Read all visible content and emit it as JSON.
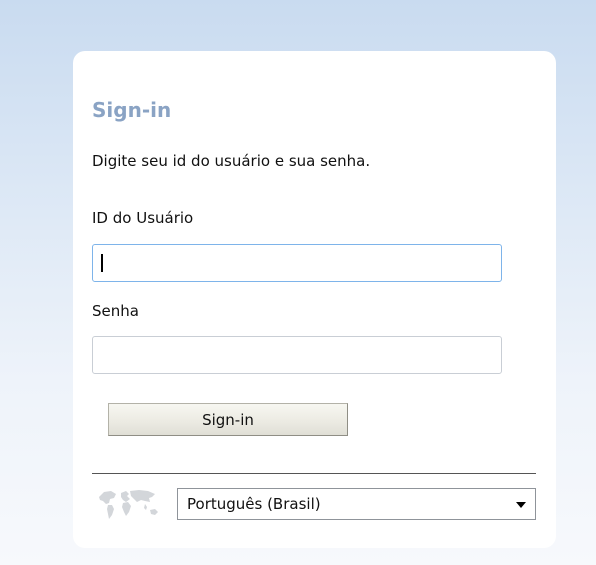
{
  "login": {
    "title": "Sign-in",
    "subtitle": "Digite seu id do usuário e sua senha.",
    "user_label": "ID do Usuário",
    "user_value": "",
    "password_label": "Senha",
    "password_value": "",
    "submit_label": "Sign-in"
  },
  "language": {
    "selected": "Português (Brasil)",
    "icon": "globe-icon"
  },
  "colors": {
    "title": "#8aa3c4",
    "background_top": "#c9dbf0",
    "focus_border": "#7eb4ea"
  }
}
